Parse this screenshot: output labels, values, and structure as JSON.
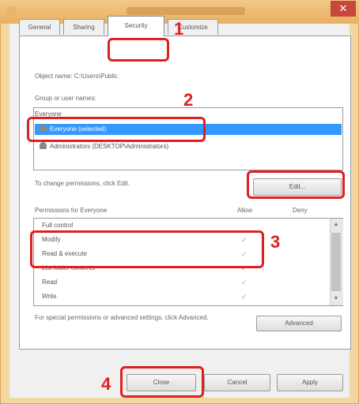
{
  "dialog": {
    "title": "",
    "close_glyph": "✕"
  },
  "tabs": [
    {
      "label": "General"
    },
    {
      "label": "Sharing"
    },
    {
      "label": "Security"
    },
    {
      "label": "Customize"
    }
  ],
  "security": {
    "object_name": "Object name:   C:\\Users\\Public",
    "groups_label": "Group or user names:",
    "groups_header": "Everyone",
    "users": [
      {
        "name": "Everyone (selected)",
        "selected": true
      },
      {
        "name": "Administrators (DESKTOP\\Administrators)",
        "selected": false
      }
    ],
    "change_hint": "To change permissions, click Edit.",
    "edit_button": "Edit...",
    "permissions_label": "Permissions for Everyone",
    "allow_label": "Allow",
    "deny_label": "Deny",
    "permissions": [
      {
        "name": "Full control",
        "allow": "",
        "deny": ""
      },
      {
        "name": "Modify",
        "allow": "✓",
        "deny": ""
      },
      {
        "name": "Read & execute",
        "allow": "✓",
        "deny": ""
      },
      {
        "name": "List folder contents",
        "allow": "✓",
        "deny": ""
      },
      {
        "name": "Read",
        "allow": "✓",
        "deny": ""
      },
      {
        "name": "Write",
        "allow": "✓",
        "deny": ""
      }
    ],
    "advanced_hint": "For special permissions or advanced settings, click Advanced.",
    "advanced_button": "Advanced"
  },
  "footer": {
    "close_button": "Close",
    "cancel_button": "Cancel",
    "apply_button": "Apply"
  },
  "annotations": [
    "1",
    "2",
    "3",
    "4"
  ],
  "colors": {
    "annotation": "#e02020",
    "selection": "#3399ff",
    "frame": "#f3d7a0",
    "close_button": "#c9463a"
  }
}
